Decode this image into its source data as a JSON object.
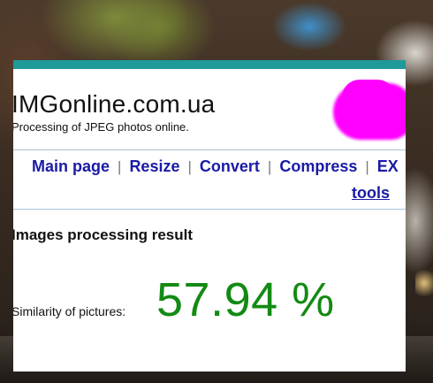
{
  "site": {
    "logo": "IMGonline.com.ua",
    "tagline": "Processing of JPEG photos online."
  },
  "nav": {
    "items": [
      {
        "label": "Main page"
      },
      {
        "label": "Resize"
      },
      {
        "label": "Convert"
      },
      {
        "label": "Compress"
      },
      {
        "label": "EX"
      }
    ],
    "separator": "|",
    "continuation": "tools"
  },
  "result": {
    "heading": "Images processing result",
    "similarity_label": "Similarity of pictures:",
    "similarity_value": "57.94 %"
  },
  "colors": {
    "topbar": "#1f9a9a",
    "nav_link": "#1a1aa6",
    "similarity_value": "#138a13",
    "ad_placeholder": "#ff00ff"
  }
}
